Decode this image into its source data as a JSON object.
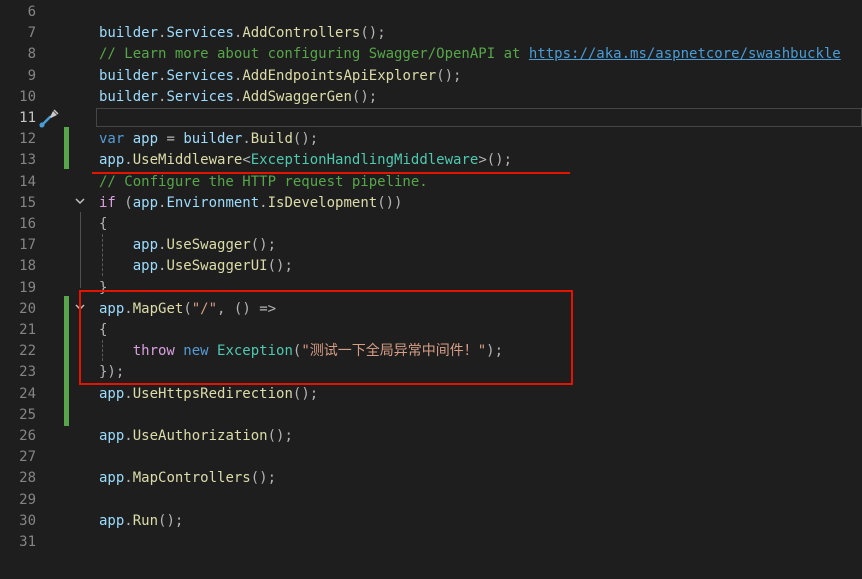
{
  "editor": {
    "lines": [
      {
        "n": "6",
        "tokens": []
      },
      {
        "n": "7",
        "tokens": [
          {
            "t": "builder",
            "c": "tok-var"
          },
          {
            "t": ".",
            "c": "tok-punct"
          },
          {
            "t": "Services",
            "c": "tok-var"
          },
          {
            "t": ".",
            "c": "tok-punct"
          },
          {
            "t": "AddControllers",
            "c": "tok-method"
          },
          {
            "t": "();",
            "c": "tok-punct"
          }
        ]
      },
      {
        "n": "8",
        "tokens": [
          {
            "t": "// Learn more about configuring Swagger/OpenAPI at ",
            "c": "tok-comment"
          },
          {
            "t": "https://aka.ms/aspnetcore/swashbuckle",
            "c": "tok-link"
          }
        ]
      },
      {
        "n": "9",
        "tokens": [
          {
            "t": "builder",
            "c": "tok-var"
          },
          {
            "t": ".",
            "c": "tok-punct"
          },
          {
            "t": "Services",
            "c": "tok-var"
          },
          {
            "t": ".",
            "c": "tok-punct"
          },
          {
            "t": "AddEndpointsApiExplorer",
            "c": "tok-method"
          },
          {
            "t": "();",
            "c": "tok-punct"
          }
        ]
      },
      {
        "n": "10",
        "tokens": [
          {
            "t": "builder",
            "c": "tok-var"
          },
          {
            "t": ".",
            "c": "tok-punct"
          },
          {
            "t": "Services",
            "c": "tok-var"
          },
          {
            "t": ".",
            "c": "tok-punct"
          },
          {
            "t": "AddSwaggerGen",
            "c": "tok-method"
          },
          {
            "t": "();",
            "c": "tok-punct"
          }
        ]
      },
      {
        "n": "11",
        "tokens": []
      },
      {
        "n": "12",
        "tokens": [
          {
            "t": "var",
            "c": "tok-kw"
          },
          {
            "t": " app ",
            "c": "tok-var"
          },
          {
            "t": "= ",
            "c": "tok-punct"
          },
          {
            "t": "builder",
            "c": "tok-var"
          },
          {
            "t": ".",
            "c": "tok-punct"
          },
          {
            "t": "Build",
            "c": "tok-method"
          },
          {
            "t": "();",
            "c": "tok-punct"
          }
        ]
      },
      {
        "n": "13",
        "tokens": [
          {
            "t": "app",
            "c": "tok-var"
          },
          {
            "t": ".",
            "c": "tok-punct"
          },
          {
            "t": "UseMiddleware",
            "c": "tok-method"
          },
          {
            "t": "<",
            "c": "tok-punct"
          },
          {
            "t": "ExceptionHandlingMiddleware",
            "c": "tok-type"
          },
          {
            "t": ">();",
            "c": "tok-punct"
          }
        ]
      },
      {
        "n": "14",
        "tokens": [
          {
            "t": "// Configure the HTTP request pipeline.",
            "c": "tok-comment"
          }
        ]
      },
      {
        "n": "15",
        "tokens": [
          {
            "t": "if",
            "c": "tok-kwc"
          },
          {
            "t": " (",
            "c": "tok-punct"
          },
          {
            "t": "app",
            "c": "tok-var"
          },
          {
            "t": ".",
            "c": "tok-punct"
          },
          {
            "t": "Environment",
            "c": "tok-var"
          },
          {
            "t": ".",
            "c": "tok-punct"
          },
          {
            "t": "IsDevelopment",
            "c": "tok-method"
          },
          {
            "t": "())",
            "c": "tok-punct"
          }
        ]
      },
      {
        "n": "16",
        "tokens": [
          {
            "t": "{",
            "c": "tok-punct"
          }
        ]
      },
      {
        "n": "17",
        "tokens": [
          {
            "t": "    app",
            "c": "tok-var"
          },
          {
            "t": ".",
            "c": "tok-punct"
          },
          {
            "t": "UseSwagger",
            "c": "tok-method"
          },
          {
            "t": "();",
            "c": "tok-punct"
          }
        ]
      },
      {
        "n": "18",
        "tokens": [
          {
            "t": "    app",
            "c": "tok-var"
          },
          {
            "t": ".",
            "c": "tok-punct"
          },
          {
            "t": "UseSwaggerUI",
            "c": "tok-method"
          },
          {
            "t": "();",
            "c": "tok-punct"
          }
        ]
      },
      {
        "n": "19",
        "tokens": [
          {
            "t": "}",
            "c": "tok-punct"
          }
        ]
      },
      {
        "n": "20",
        "tokens": [
          {
            "t": "app",
            "c": "tok-var"
          },
          {
            "t": ".",
            "c": "tok-punct"
          },
          {
            "t": "MapGet",
            "c": "tok-method"
          },
          {
            "t": "(",
            "c": "tok-punct"
          },
          {
            "t": "\"/\"",
            "c": "tok-str"
          },
          {
            "t": ", () =>",
            "c": "tok-punct"
          }
        ]
      },
      {
        "n": "21",
        "tokens": [
          {
            "t": "{",
            "c": "tok-punct"
          }
        ]
      },
      {
        "n": "22",
        "tokens": [
          {
            "t": "    throw",
            "c": "tok-kwc"
          },
          {
            "t": " new ",
            "c": "tok-kw"
          },
          {
            "t": "Exception",
            "c": "tok-type"
          },
          {
            "t": "(",
            "c": "tok-punct"
          },
          {
            "t": "\"测试一下全局异常中间件！\"",
            "c": "tok-str"
          },
          {
            "t": ");",
            "c": "tok-punct"
          }
        ]
      },
      {
        "n": "23",
        "tokens": [
          {
            "t": "});",
            "c": "tok-punct"
          }
        ]
      },
      {
        "n": "24",
        "tokens": [
          {
            "t": "app",
            "c": "tok-var"
          },
          {
            "t": ".",
            "c": "tok-punct"
          },
          {
            "t": "UseHttpsRedirection",
            "c": "tok-method"
          },
          {
            "t": "();",
            "c": "tok-punct"
          }
        ]
      },
      {
        "n": "25",
        "tokens": []
      },
      {
        "n": "26",
        "tokens": [
          {
            "t": "app",
            "c": "tok-var"
          },
          {
            "t": ".",
            "c": "tok-punct"
          },
          {
            "t": "UseAuthorization",
            "c": "tok-method"
          },
          {
            "t": "();",
            "c": "tok-punct"
          }
        ]
      },
      {
        "n": "27",
        "tokens": []
      },
      {
        "n": "28",
        "tokens": [
          {
            "t": "app",
            "c": "tok-var"
          },
          {
            "t": ".",
            "c": "tok-punct"
          },
          {
            "t": "MapControllers",
            "c": "tok-method"
          },
          {
            "t": "();",
            "c": "tok-punct"
          }
        ]
      },
      {
        "n": "29",
        "tokens": []
      },
      {
        "n": "30",
        "tokens": [
          {
            "t": "app",
            "c": "tok-var"
          },
          {
            "t": ".",
            "c": "tok-punct"
          },
          {
            "t": "Run",
            "c": "tok-method"
          },
          {
            "t": "();",
            "c": "tok-punct"
          }
        ]
      },
      {
        "n": "31",
        "tokens": []
      }
    ],
    "active_line": "11",
    "fold_icon": "chevron-down-icon",
    "quick_action_icon": "screwdriver-brush-icon"
  },
  "annotations": {
    "color": "#e51400"
  }
}
